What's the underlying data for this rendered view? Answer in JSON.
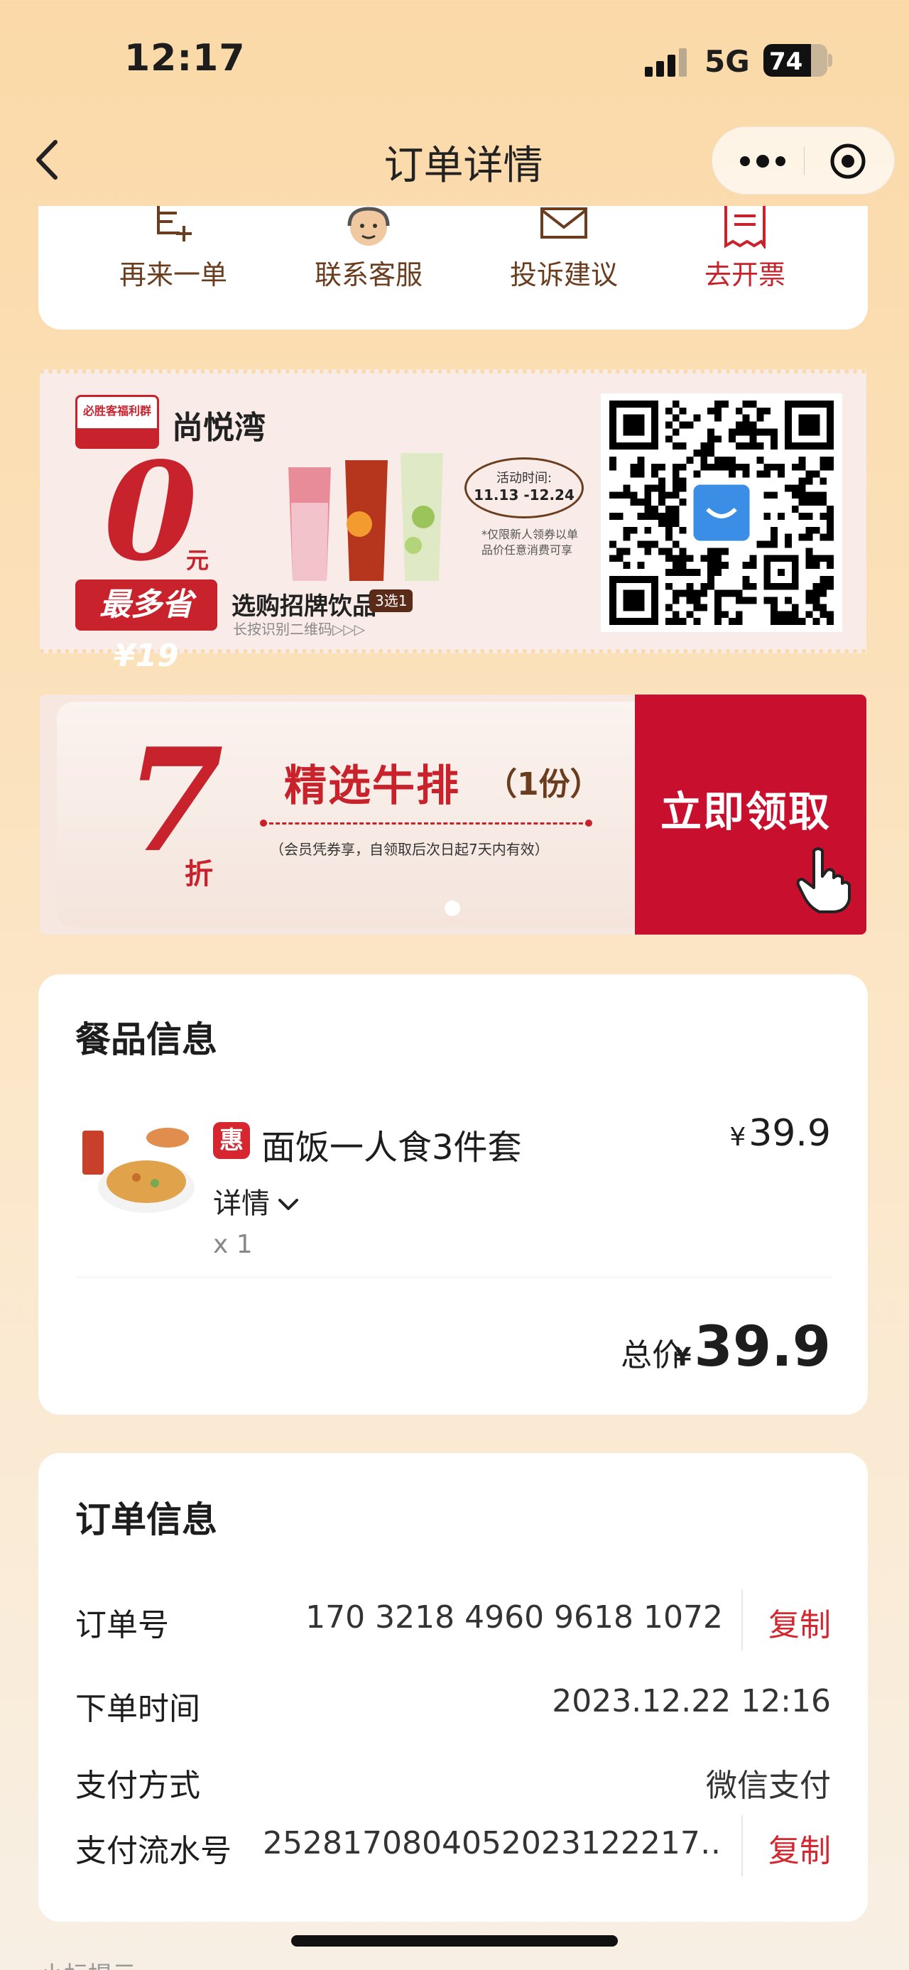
{
  "status_bar": {
    "time": "12:17",
    "network": "5G",
    "battery": "74",
    "battery_level": 0.74
  },
  "nav": {
    "title": "订单详情"
  },
  "actions": [
    {
      "label": "再来一单",
      "icon": "reorder-icon"
    },
    {
      "label": "联系客服",
      "icon": "customer-service-icon"
    },
    {
      "label": "投诉建议",
      "icon": "mail-icon"
    },
    {
      "label": "去开票",
      "icon": "invoice-icon"
    }
  ],
  "promo_drinks": {
    "logo_text": "必胜客福利群",
    "store": "尚悦湾",
    "big_value": "0",
    "unit": "元",
    "save_text": "最多省¥19",
    "activity_label": "活动时间:",
    "activity_dates": "11.13 -12.24",
    "note": "*仅限新人领券以单品价任意消费可享",
    "headline": "选购招牌饮品",
    "tag": "3选1",
    "sub": "长按识别二维码▷▷▷"
  },
  "promo_steak": {
    "value": "7",
    "unit": "折",
    "title": "精选牛排",
    "qty": "（1份）",
    "note": "（会员凭券享，自领取后次日起7天内有效）",
    "button": "立即领取"
  },
  "food": {
    "section_title": "餐品信息",
    "badge": "惠",
    "name": "面饭一人食3件套",
    "currency": "¥",
    "price": "39.9",
    "detail_label": "详情",
    "quantity": "x 1",
    "total_label": "总价",
    "total": "39.9"
  },
  "order": {
    "section_title": "订单信息",
    "rows": [
      {
        "label": "订单号",
        "value": "170 3218 4960 9618 1072",
        "action": "复制"
      },
      {
        "label": "下单时间",
        "value": "2023.12.22 12:16"
      },
      {
        "label": "支付方式",
        "value": "微信支付"
      },
      {
        "label": "支付流水号",
        "value": "25281708040520231222​17…",
        "action": "复制"
      }
    ]
  },
  "peek_text": "小标提示"
}
